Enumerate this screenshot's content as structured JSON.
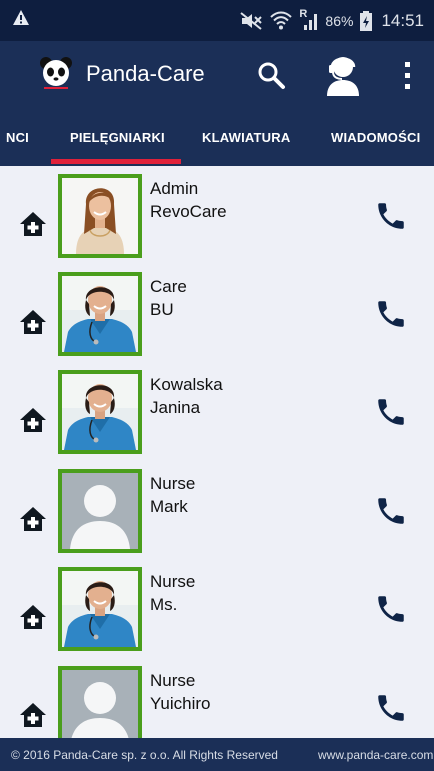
{
  "status_bar": {
    "battery_percent": "86%",
    "clock": "14:51",
    "network_label": "R",
    "icons": [
      "warning-icon",
      "mute-icon",
      "wifi-icon",
      "signal-icon",
      "battery-icon"
    ]
  },
  "app_bar": {
    "title": "Panda-Care",
    "icons": [
      "panda-logo",
      "search-icon",
      "agent-icon",
      "more-vert-icon"
    ]
  },
  "tabs": [
    {
      "label": "NCI",
      "selected": false
    },
    {
      "label": "PIELĘGNIARKI",
      "selected": true
    },
    {
      "label": "KLAWIATURA",
      "selected": false
    },
    {
      "label": "WIADOMOŚCI",
      "selected": false
    }
  ],
  "contacts": [
    {
      "line1": "Admin",
      "line2": "RevoCare",
      "avatar": "woman-long-hair"
    },
    {
      "line1": "Care",
      "line2": "BU",
      "avatar": "nurse-scrubs"
    },
    {
      "line1": "Kowalska",
      "line2": "Janina",
      "avatar": "nurse-scrubs"
    },
    {
      "line1": "Nurse",
      "line2": "Mark",
      "avatar": "placeholder"
    },
    {
      "line1": "Nurse",
      "line2": "Ms.",
      "avatar": "nurse-scrubs"
    },
    {
      "line1": "Nurse",
      "line2": "Yuichiro",
      "avatar": "placeholder"
    }
  ],
  "footer": {
    "copyright": "© 2016 Panda-Care sp. z o.o. All Rights Reserved",
    "website": "www.panda-care.com"
  },
  "colors": {
    "status_bar_bg": "#0e1e3f",
    "app_bar_bg": "#1b2f57",
    "tab_indicator": "#e0213a",
    "avatar_border": "#4a9e1c",
    "list_bg": "#eef0f7",
    "phone_icon": "#0f2447"
  }
}
